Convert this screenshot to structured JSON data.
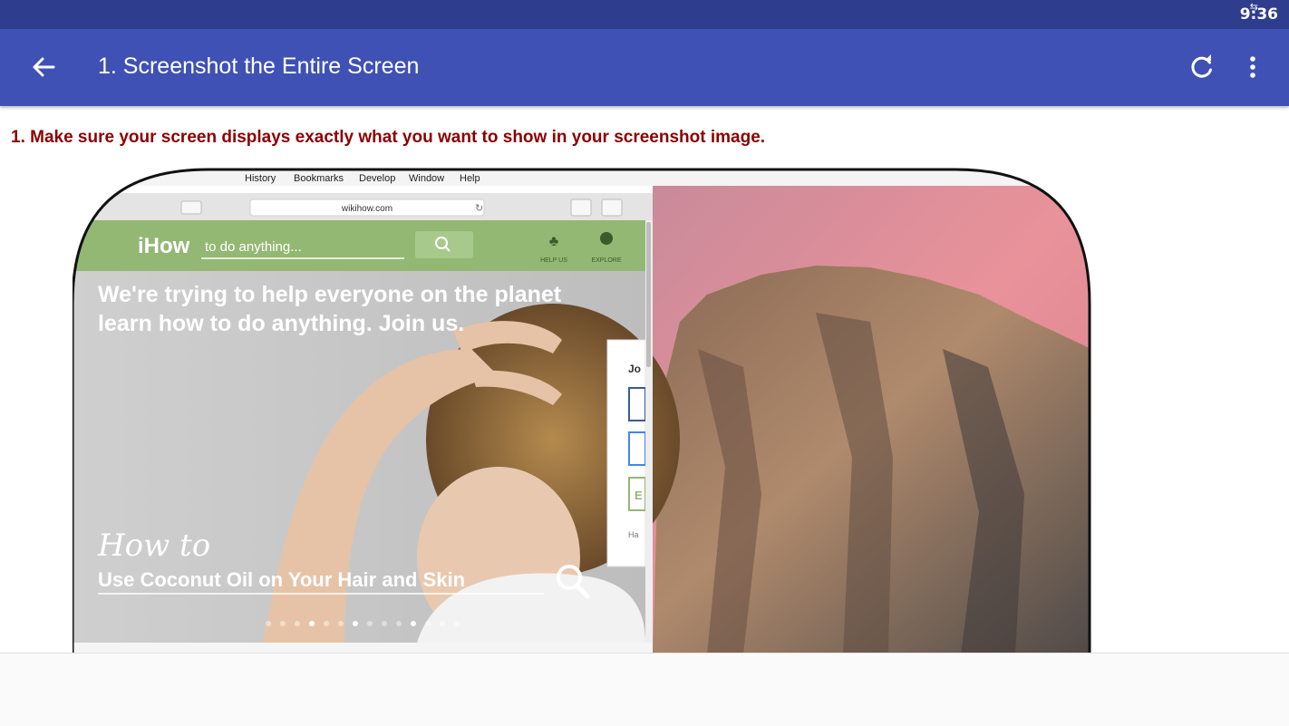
{
  "status_bar": {
    "time": "9:36",
    "sync_glyph": "⇆"
  },
  "toolbar": {
    "title": "1. Screenshot the Entire Screen",
    "back_icon": "arrow-back-icon",
    "refresh_icon": "refresh-icon",
    "menu_icon": "more-vert-icon"
  },
  "step": {
    "text": "1. Make sure your screen displays exactly what you want to show in your screenshot image."
  },
  "illustration": {
    "menu_bar_items": [
      "History",
      "Bookmarks",
      "Develop",
      "Window",
      "Help"
    ],
    "browser_url": "wikihow.com",
    "site_logo": "iHow",
    "search_placeholder": "to do anything...",
    "nav_help_label": "HELP US",
    "nav_explore_label": "EXPLORE",
    "hero_line1": "We're trying to help everyone on the planet",
    "hero_line2": "learn how to do anything. Join us.",
    "howto_script": "How to",
    "howto_title": "Use Coconut Oil on Your Hair and Skin",
    "popup_heading": "Jo",
    "popup_footer": "Ha",
    "popup_letter": "E",
    "carousel": {
      "count": 14,
      "active": [
        3,
        6,
        10
      ]
    },
    "colors": {
      "wikihow_green": "#93b874",
      "title_red": "#8b0000",
      "toolbar_blue": "#3f51b5",
      "status_blue": "#2f3d8f"
    }
  }
}
